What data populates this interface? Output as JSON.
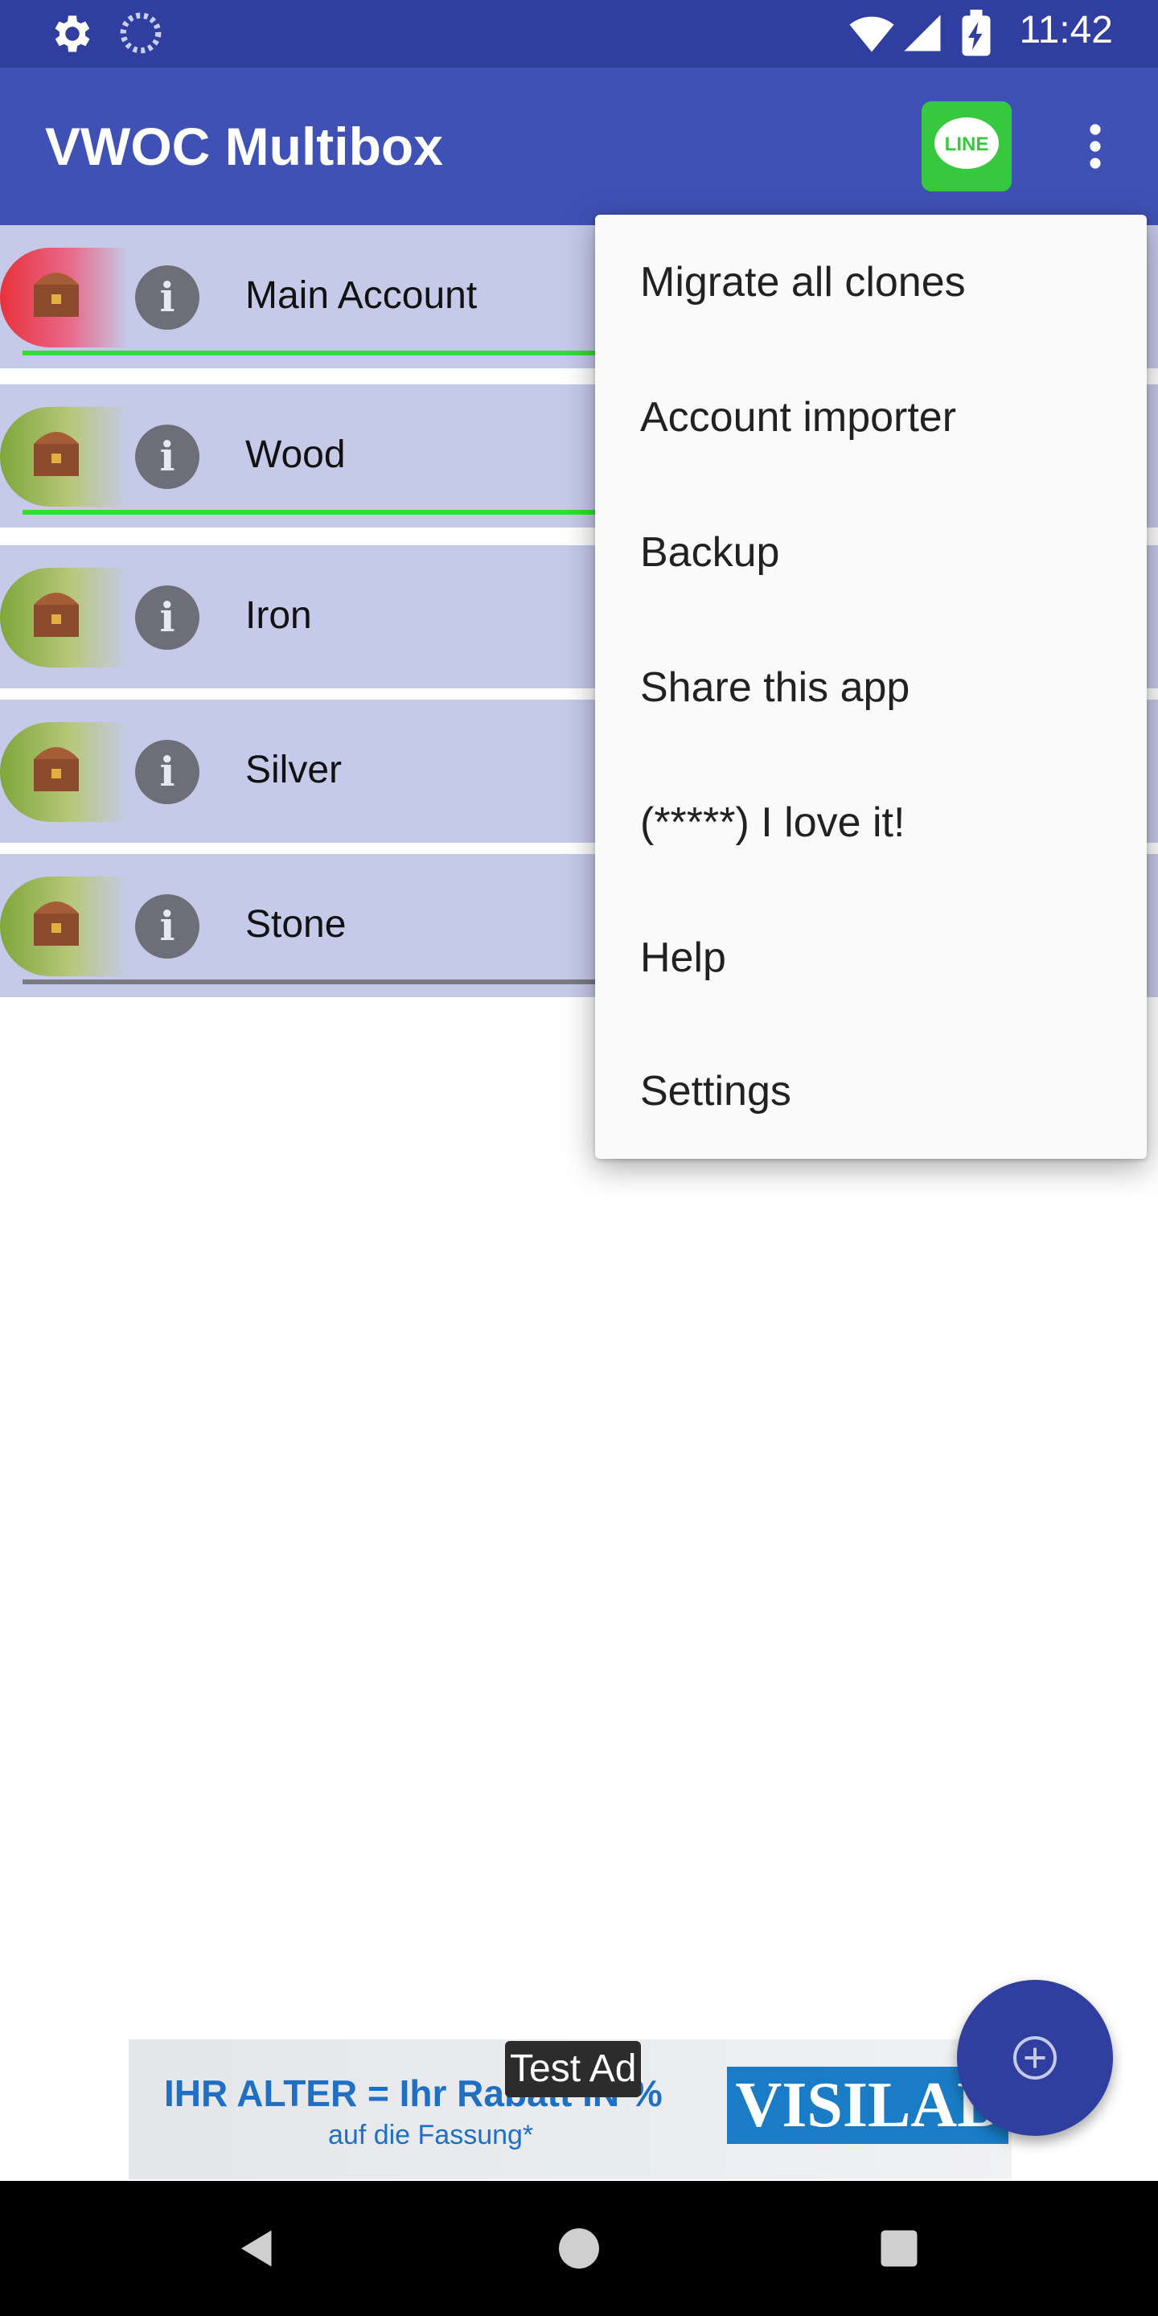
{
  "status_bar": {
    "time": "11:42",
    "left_icons": [
      "gear-icon",
      "loading-icon"
    ],
    "right_icons": [
      "wifi-icon",
      "signal-icon",
      "battery-charging-icon"
    ]
  },
  "app_bar": {
    "title": "VWOC Multibox",
    "line_button_label": "LINE",
    "overflow_icon": "more-vert-icon"
  },
  "accounts": [
    {
      "label": "Main Account",
      "avatar_color": "#e8323c",
      "progress_color": "#33dd33"
    },
    {
      "label": "Wood",
      "avatar_color": "#7fa63a",
      "progress_color": "#33dd33"
    },
    {
      "label": "Iron",
      "avatar_color": "#7fa63a",
      "progress_color": null
    },
    {
      "label": "Silver",
      "avatar_color": "#7fa63a",
      "progress_color": null
    },
    {
      "label": "Stone",
      "avatar_color": "#7fa63a",
      "progress_color": "#7a7a80"
    }
  ],
  "account_info_glyph": "i",
  "menu": {
    "items": [
      "Migrate all clones",
      "Account importer",
      "Backup",
      "Share this app",
      "(*****) I love it!",
      "Help",
      "Settings"
    ]
  },
  "fab": {
    "icon": "add-circle-icon"
  },
  "ad": {
    "label": "Test Ad",
    "headline": "IHR ALTER = Ihr Rabatt IN %",
    "subline": "auf die Fassung*",
    "brand": "VISILAB"
  },
  "nav_bar": {
    "icons": [
      "back-icon",
      "home-icon",
      "recents-icon"
    ]
  },
  "colors": {
    "status_bar": "#303f9f",
    "app_bar": "#3f51b5",
    "row_background": "#c5cae9",
    "fab": "#303f9f",
    "line_green": "#36c83f"
  }
}
